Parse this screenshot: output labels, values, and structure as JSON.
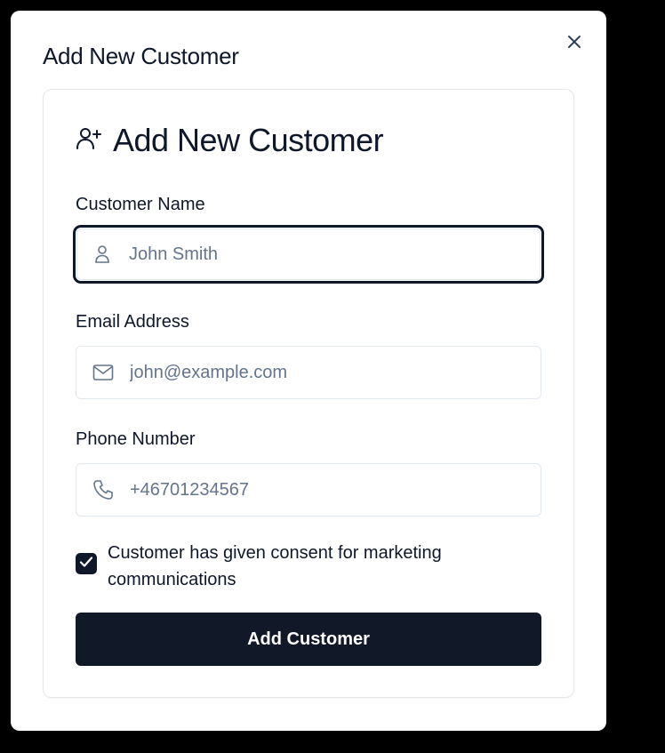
{
  "dialog": {
    "title": "Add New Customer",
    "close_icon": "close-icon"
  },
  "card": {
    "title": "Add New Customer",
    "title_icon": "user-plus-icon"
  },
  "fields": {
    "name": {
      "label": "Customer Name",
      "value": "",
      "placeholder": "John Smith",
      "icon": "user-icon",
      "focused": true
    },
    "email": {
      "label": "Email Address",
      "value": "",
      "placeholder": "john@example.com",
      "icon": "mail-icon"
    },
    "phone": {
      "label": "Phone Number",
      "value": "",
      "placeholder": "+46701234567",
      "icon": "phone-icon"
    }
  },
  "consent": {
    "checked": true,
    "label": "Customer has given consent for marketing communications"
  },
  "submit": {
    "label": "Add Customer"
  },
  "colors": {
    "primary": "#0f172a",
    "button": "#111827",
    "border": "#e2e8f0",
    "placeholder": "#64748b",
    "icon": "#64748b",
    "backdrop": "#000000"
  }
}
